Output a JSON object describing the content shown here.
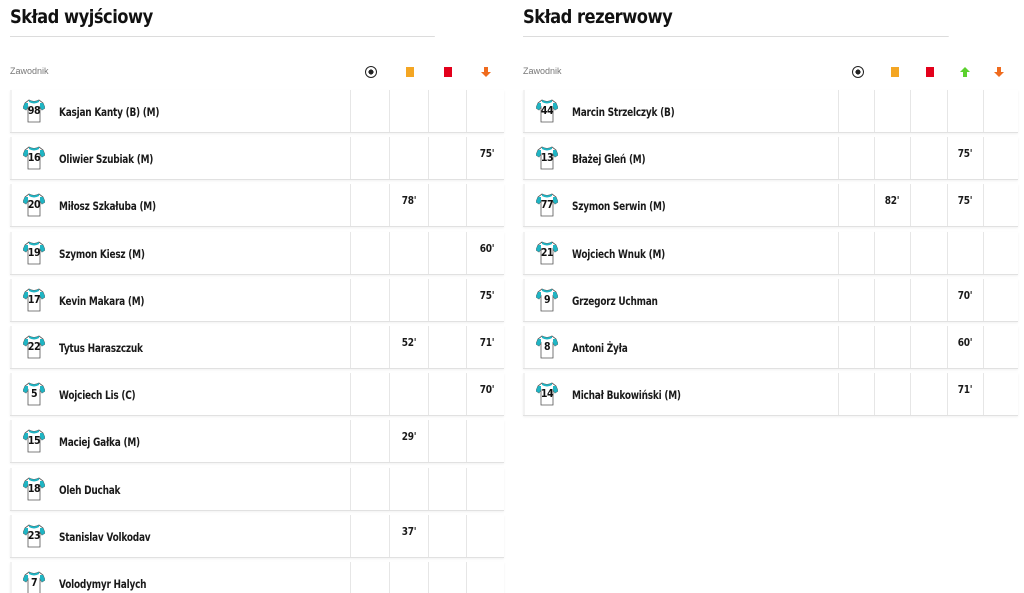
{
  "starting": {
    "title": "Skład wyjściowy",
    "column_label": "Zawodnik",
    "icons": [
      "goal-ball-icon",
      "yellow-card-icon",
      "red-card-icon",
      "sub-out-icon"
    ],
    "players": [
      {
        "number": "98",
        "name": "Kasjan Kanty (B) (M)",
        "goal": "",
        "yellow": "",
        "red": "",
        "out": ""
      },
      {
        "number": "16",
        "name": "Oliwier Szubiak (M)",
        "goal": "",
        "yellow": "",
        "red": "",
        "out": "75'"
      },
      {
        "number": "20",
        "name": "Miłosz Szkałuba (M)",
        "goal": "",
        "yellow": "78'",
        "red": "",
        "out": ""
      },
      {
        "number": "19",
        "name": "Szymon Kiesz (M)",
        "goal": "",
        "yellow": "",
        "red": "",
        "out": "60'"
      },
      {
        "number": "17",
        "name": "Kevin Makara (M)",
        "goal": "",
        "yellow": "",
        "red": "",
        "out": "75'"
      },
      {
        "number": "22",
        "name": "Tytus Haraszczuk",
        "goal": "",
        "yellow": "52'",
        "red": "",
        "out": "71'"
      },
      {
        "number": "5",
        "name": "Wojciech Lis (C)",
        "goal": "",
        "yellow": "",
        "red": "",
        "out": "70'"
      },
      {
        "number": "15",
        "name": "Maciej Gałka (M)",
        "goal": "",
        "yellow": "29'",
        "red": "",
        "out": ""
      },
      {
        "number": "18",
        "name": "Oleh Duchak",
        "goal": "",
        "yellow": "",
        "red": "",
        "out": ""
      },
      {
        "number": "23",
        "name": "Stanislav Volkodav",
        "goal": "",
        "yellow": "37'",
        "red": "",
        "out": ""
      },
      {
        "number": "7",
        "name": "Volodymyr Halych",
        "goal": "",
        "yellow": "",
        "red": "",
        "out": ""
      }
    ]
  },
  "reserve": {
    "title": "Skład rezerwowy",
    "column_label": "Zawodnik",
    "icons": [
      "goal-ball-icon",
      "yellow-card-icon",
      "red-card-icon",
      "sub-in-icon",
      "sub-out-icon"
    ],
    "players": [
      {
        "number": "44",
        "name": "Marcin Strzelczyk (B)",
        "goal": "",
        "yellow": "",
        "red": "",
        "in": "",
        "out": ""
      },
      {
        "number": "13",
        "name": "Błażej Gleń (M)",
        "goal": "",
        "yellow": "",
        "red": "",
        "in": "75'",
        "out": ""
      },
      {
        "number": "77",
        "name": "Szymon Serwin (M)",
        "goal": "",
        "yellow": "82'",
        "red": "",
        "in": "75'",
        "out": ""
      },
      {
        "number": "21",
        "name": "Wojciech Wnuk (M)",
        "goal": "",
        "yellow": "",
        "red": "",
        "in": "",
        "out": ""
      },
      {
        "number": "9",
        "name": "Grzegorz Uchman",
        "goal": "",
        "yellow": "",
        "red": "",
        "in": "70'",
        "out": ""
      },
      {
        "number": "8",
        "name": "Antoni Żyła",
        "goal": "",
        "yellow": "",
        "red": "",
        "in": "60'",
        "out": ""
      },
      {
        "number": "14",
        "name": "Michał Bukowiński (M)",
        "goal": "",
        "yellow": "",
        "red": "",
        "in": "71'",
        "out": ""
      }
    ]
  },
  "colors": {
    "shirt_accent": "#1fb5c4",
    "yellow_card": "#f4a623",
    "red_card": "#e3001b",
    "sub_in": "#5bd12d",
    "sub_out": "#ef6b1e"
  }
}
